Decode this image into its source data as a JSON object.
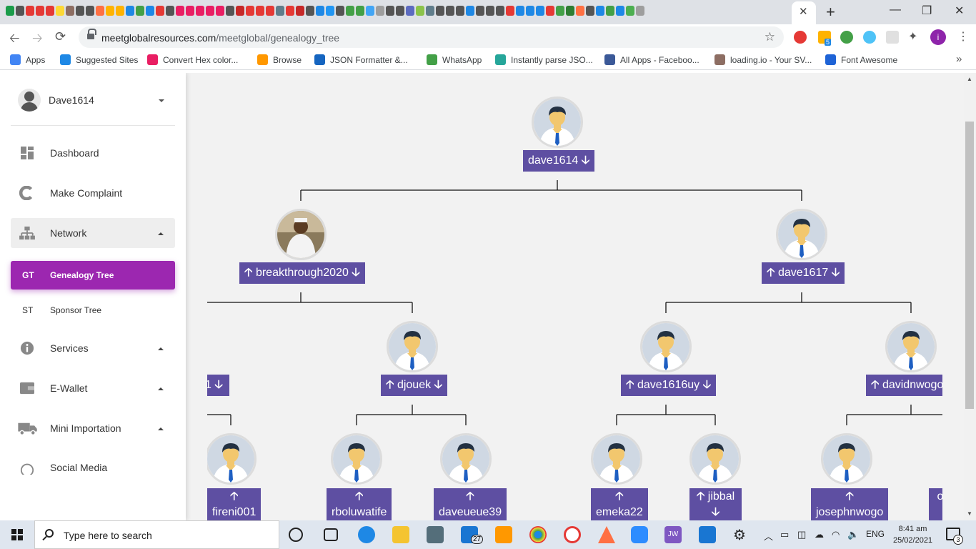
{
  "browser": {
    "url_domain": "meetglobalresources.com",
    "url_path": "/meetglobal/genealogy_tree",
    "tab_close": "✕",
    "new_tab": "+",
    "window_min": "—",
    "window_max": "❐",
    "window_close": "✕",
    "profile_initial": "i",
    "ext_badge": "5",
    "favicon_colors": [
      "#1a9c4a",
      "#555",
      "#e53935",
      "#e53935",
      "#e53935",
      "#fdd835",
      "#8d6e63",
      "#555",
      "#555",
      "#ff7043",
      "#ffb300",
      "#ffb300",
      "#1e88e5",
      "#43a047",
      "#1e88e5",
      "#e53935",
      "#555",
      "#e91e63",
      "#e91e63",
      "#e91e63",
      "#e91e63",
      "#e91e63",
      "#555",
      "#c62828",
      "#e53935",
      "#e53935",
      "#e53935",
      "#607d8b",
      "#e53935",
      "#c62828",
      "#555",
      "#1e88e5",
      "#2196f3",
      "#555",
      "#43a047",
      "#43a047",
      "#42a5f5",
      "#9e9e9e",
      "#555",
      "#555",
      "#5c6bc0",
      "#8bc34a",
      "#607d8b",
      "#555",
      "#555",
      "#555",
      "#1e88e5",
      "#555",
      "#555",
      "#555",
      "#e53935",
      "#1e88e5",
      "#1e88e5",
      "#1e88e5",
      "#e53935",
      "#43a047",
      "#2e7d32",
      "#ff7043",
      "#555",
      "#1e88e5",
      "#43a047",
      "#1e88e5",
      "#4caf50",
      "#9e9e9e"
    ]
  },
  "bookmarks": [
    {
      "label": "Apps",
      "color": "#4285f4"
    },
    {
      "label": "Suggested Sites",
      "color": "#1e88e5"
    },
    {
      "label": "Convert Hex color...",
      "color": "#e91e63"
    },
    {
      "label": "Browse",
      "color": "#ff9800"
    },
    {
      "label": "JSON Formatter &...",
      "color": "#1565c0"
    },
    {
      "label": "WhatsApp",
      "color": "#43a047"
    },
    {
      "label": "Instantly parse JSO...",
      "color": "#26a69a"
    },
    {
      "label": "All Apps - Faceboo...",
      "color": "#3b5998"
    },
    {
      "label": "loading.io - Your SV...",
      "color": "#8d6e63"
    },
    {
      "label": "Font Awesome",
      "color": "#1e63d6"
    }
  ],
  "sidebar": {
    "username": "Dave1614",
    "items": [
      {
        "label": "Dashboard",
        "icon": "dashboard-icon"
      },
      {
        "label": "Make Complaint",
        "icon": "complaint-icon"
      },
      {
        "label": "Network",
        "icon": "network-icon"
      },
      {
        "label": "Services",
        "icon": "info-icon"
      },
      {
        "label": "E-Wallet",
        "icon": "wallet-icon"
      },
      {
        "label": "Mini Importation",
        "icon": "truck-icon"
      },
      {
        "label": "Social Media",
        "icon": "social-icon"
      }
    ],
    "sub_items": [
      {
        "abbr": "GT",
        "label": "Genealogy Tree",
        "active": true
      },
      {
        "abbr": "ST",
        "label": "Sponsor Tree",
        "active": false
      }
    ],
    "active_color": "#9c27b0"
  },
  "tree": {
    "label_color": "#5e4fa2",
    "up_arrow": "🡡",
    "down_arrow": "🡣",
    "nodes": [
      {
        "name": "dave1614",
        "up": false,
        "down": true
      },
      {
        "name": "breakthrough2020",
        "up": true,
        "down": true
      },
      {
        "name": "dave1617",
        "up": true,
        "down": true
      },
      {
        "name": "1",
        "up": false,
        "down": true
      },
      {
        "name": "djouek",
        "up": true,
        "down": true
      },
      {
        "name": "dave1616uy",
        "up": true,
        "down": true
      },
      {
        "name": "davidnwogo",
        "up": true,
        "down": false
      },
      {
        "name": "fireni001",
        "up": true,
        "down": false
      },
      {
        "name": "rboluwatife",
        "up": true,
        "down": false
      },
      {
        "name": "daveueue39",
        "up": true,
        "down": false
      },
      {
        "name": "emeka22",
        "up": true,
        "down": false
      },
      {
        "name": "jibbal",
        "up": true,
        "down": true
      },
      {
        "name": "josephnwogo",
        "up": true,
        "down": false
      },
      {
        "name": "ok",
        "up": false,
        "down": false
      }
    ]
  },
  "taskbar": {
    "search_placeholder": "Type here to search",
    "mail_badge": "27",
    "language": "ENG",
    "time": "8:41 am",
    "date": "25/02/2021",
    "notifications": "3",
    "jw_label": "JW"
  }
}
